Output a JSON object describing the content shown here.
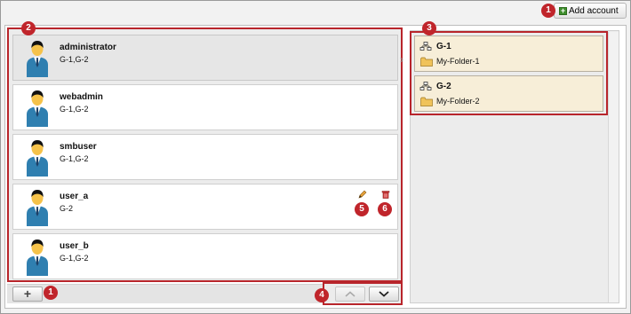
{
  "header": {
    "add_account_label": "Add account"
  },
  "callouts": {
    "add_account": "1",
    "user_list": "2",
    "group_list": "3",
    "navigation": "4",
    "edit": "5",
    "delete": "6",
    "add_button": "1"
  },
  "users": [
    {
      "name": "administrator",
      "groups": "G-1,G-2",
      "selected": true
    },
    {
      "name": "webadmin",
      "groups": "G-1,G-2"
    },
    {
      "name": "smbuser",
      "groups": "G-1,G-2"
    },
    {
      "name": "user_a",
      "groups": "G-2"
    },
    {
      "name": "user_b",
      "groups": "G-1,G-2"
    }
  ],
  "groups": [
    {
      "name": "G-1",
      "folder": "My-Folder-1"
    },
    {
      "name": "G-2",
      "folder": "My-Folder-2"
    }
  ],
  "footer": {
    "add_symbol": "+"
  },
  "colors": {
    "callout": "#c0252b",
    "highlight_border": "#b8252b",
    "group_bg": "#f7eed8",
    "suit": "#2f7fb0"
  },
  "icons": {
    "avatar": "user-avatar-icon",
    "edit": "pencil-icon",
    "delete": "trash-icon",
    "group": "network-group-icon",
    "folder": "folder-icon",
    "up": "chevron-up-icon",
    "down": "chevron-down-icon"
  }
}
